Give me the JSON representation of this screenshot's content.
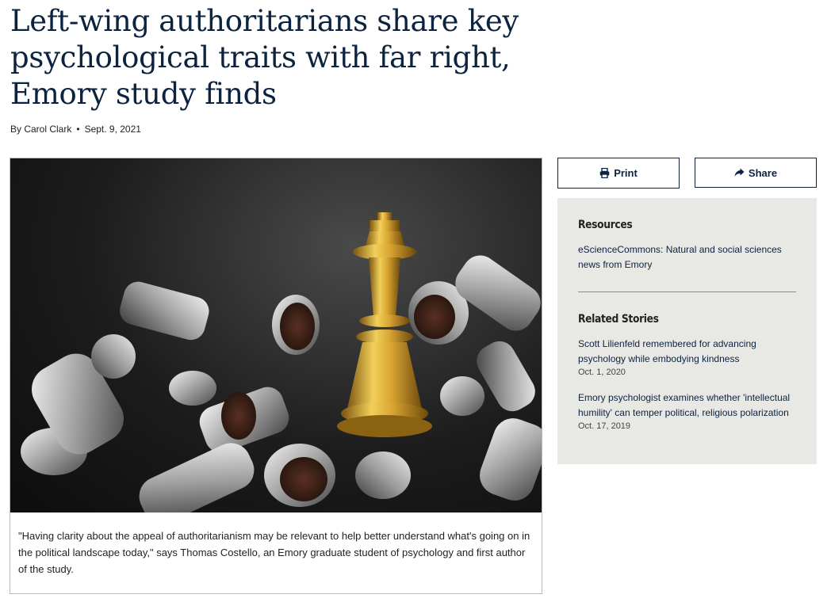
{
  "article": {
    "title": "Left-wing authoritarians share key psychological traits with far right, Emory study finds",
    "byline": "By Carol Clark",
    "date": "Sept. 9, 2021",
    "caption": "\"Having clarity about the appeal of authoritarianism may be relevant to help better understand what's going on in the political landscape today,\" says Thomas Costello, an Emory graduate student of psychology and first author of the study."
  },
  "actions": {
    "print_label": "Print",
    "share_label": "Share"
  },
  "sidebar": {
    "resources_heading": "Resources",
    "resources": [
      {
        "label": "eScienceCommons: Natural and social sciences news from Emory"
      }
    ],
    "related_heading": "Related Stories",
    "related": [
      {
        "label": "Scott Lilienfeld remembered for advancing psychology while embodying kindness",
        "date": "Oct. 1, 2020"
      },
      {
        "label": "Emory psychologist examines whether 'intellectual humility' can temper political, religious polarization",
        "date": "Oct. 17, 2019"
      }
    ]
  },
  "icons": {
    "print": "printer-icon",
    "share": "share-icon"
  },
  "colors": {
    "brand_navy": "#0c2340",
    "sidebar_bg": "#e8e8e4",
    "king_gold": "#d4a430"
  }
}
